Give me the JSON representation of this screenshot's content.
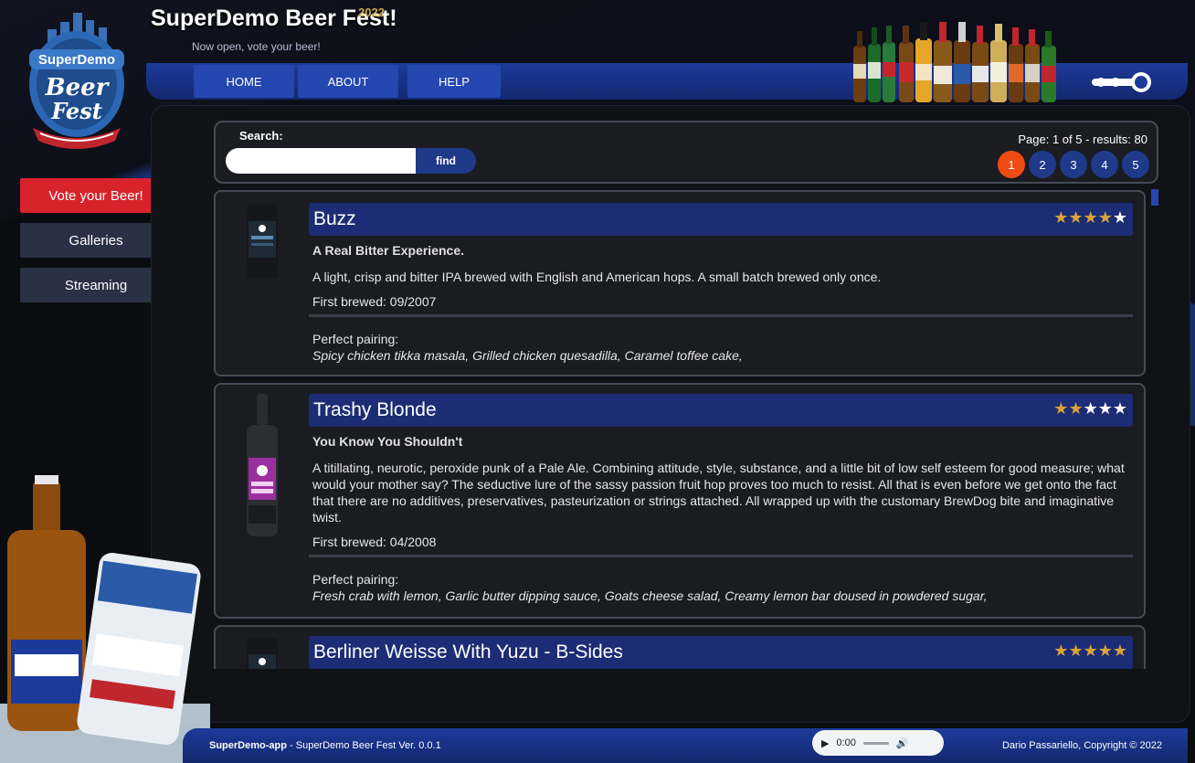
{
  "app": {
    "title": "SuperDemo Beer Fest!",
    "year": "2022",
    "subtitle": "Now open, vote your beer!",
    "logo_text": [
      "SuperDemo",
      "Beer",
      "Fest"
    ]
  },
  "nav": {
    "items": [
      {
        "label": "HOME"
      },
      {
        "label": "ABOUT"
      },
      {
        "label": "HELP"
      }
    ]
  },
  "sidebar": {
    "items": [
      {
        "label": "Vote your Beer!"
      },
      {
        "label": "Galleries"
      },
      {
        "label": "Streaming"
      }
    ]
  },
  "search": {
    "label": "Search:",
    "value": "",
    "placeholder": "",
    "button_label": "find"
  },
  "pagination": {
    "info": "Page: 1 of 5 - results: 80",
    "pages": [
      "1",
      "2",
      "3",
      "4",
      "5"
    ],
    "current": "1"
  },
  "beers": [
    {
      "name": "Buzz",
      "rating": 4,
      "rating_max": 5,
      "tagline": "A Real Bitter Experience.",
      "description": "A light, crisp and bitter IPA brewed with English and American hops. A small batch brewed only once.",
      "first_brewed": "First brewed: 09/2007",
      "pairing_label": "Perfect pairing:",
      "pairing": "Spicy chicken tikka masala, Grilled chicken quesadilla, Caramel toffee cake,"
    },
    {
      "name": "Trashy Blonde",
      "rating": 2,
      "rating_max": 5,
      "tagline": "You Know You Shouldn't",
      "description": "A titillating, neurotic, peroxide punk of a Pale Ale. Combining attitude, style, substance, and a little bit of low self esteem for good measure; what would your mother say? The seductive lure of the sassy passion fruit hop proves too much to resist. All that is even before we get onto the fact that there are no additives, preservatives, pasteurization or strings attached. All wrapped up with the customary BrewDog bite and imaginative twist.",
      "first_brewed": "First brewed: 04/2008",
      "pairing_label": "Perfect pairing:",
      "pairing": "Fresh crab with lemon, Garlic butter dipping sauce, Goats cheese salad, Creamy lemon bar doused in powdered sugar,"
    },
    {
      "name": "Berliner Weisse With Yuzu - B-Sides",
      "rating": 5,
      "rating_max": 5
    }
  ],
  "footer": {
    "app_name": "SuperDemo-app",
    "app_version": " - SuperDemo Beer Fest Ver. 0.0.1",
    "copyright": "Dario Passariello, Copyright © 2022",
    "audio_time": "0:00"
  },
  "colors": {
    "brand_blue": "#1c3a9a",
    "accent_red": "#d8232a",
    "active_page": "#f04b12",
    "star_gold": "#d9a338"
  }
}
